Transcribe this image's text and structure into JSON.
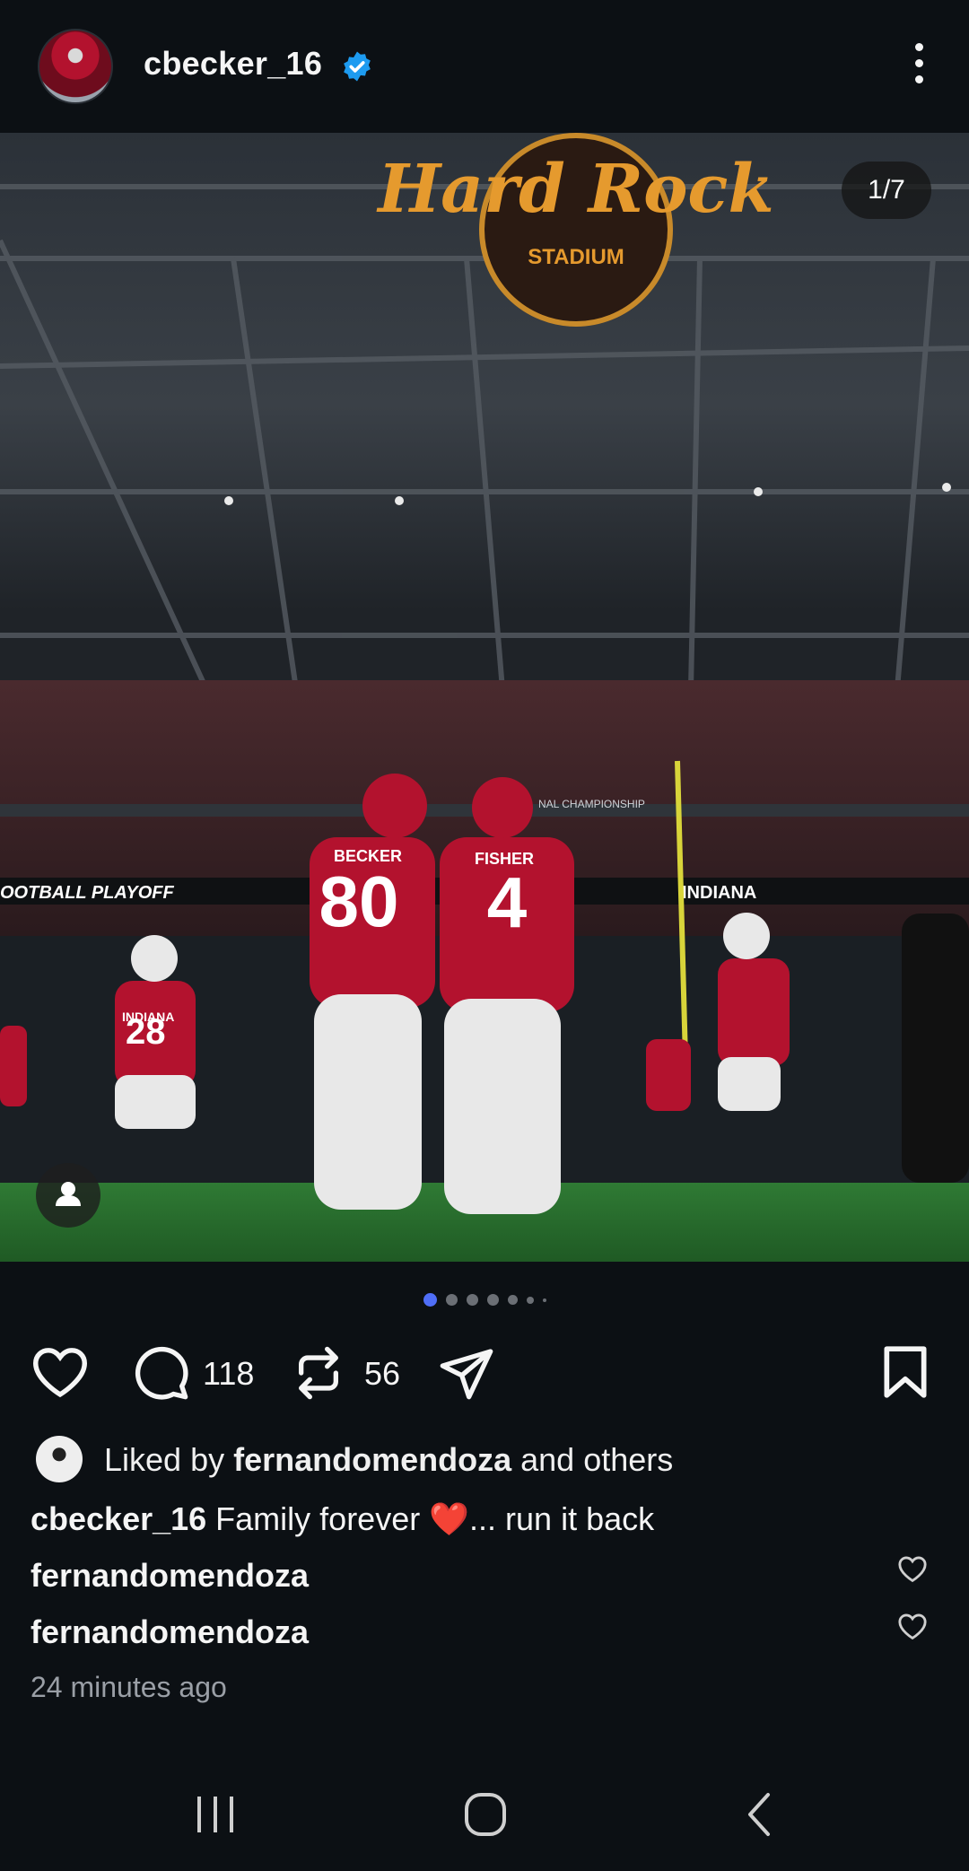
{
  "post": {
    "username": "cbecker_16",
    "verified": true,
    "counter": "1/7",
    "carousel_total": 7,
    "carousel_active": 1
  },
  "photo": {
    "stadium_sign": "Hard Rock",
    "stadium_sub": "STADIUM",
    "ribbon_left": "OOTBALL PLAYOFF",
    "ribbon_right": "INDIANA",
    "ribbon_top": "NAL CHAMPIONSHIP",
    "player_left_name": "BECKER",
    "player_left_number": "80",
    "player_right_name": "FISHER",
    "player_right_number": "4",
    "player_side_number": "28",
    "player_side_name": "INDIANA"
  },
  "actions": {
    "comments_count": "118",
    "reposts_count": "56"
  },
  "likes": {
    "prefix": "Liked by ",
    "user": "fernandomendoza",
    "suffix": " and others"
  },
  "caption": {
    "username": "cbecker_16",
    "text": " Family forever ❤️... run it back"
  },
  "comments": [
    {
      "username": "fernandomendoza"
    },
    {
      "username": "fernandomendoza"
    }
  ],
  "timestamp": "24 minutes ago",
  "icons": {
    "more": "more-vertical-icon",
    "like": "heart-icon",
    "comment": "comment-icon",
    "repost": "repost-icon",
    "share": "send-icon",
    "save": "bookmark-icon"
  },
  "colors": {
    "background": "#0c1014",
    "verified": "#1d9bf0",
    "active_dot": "#4f6ef7",
    "jersey_red": "#b3122e"
  }
}
